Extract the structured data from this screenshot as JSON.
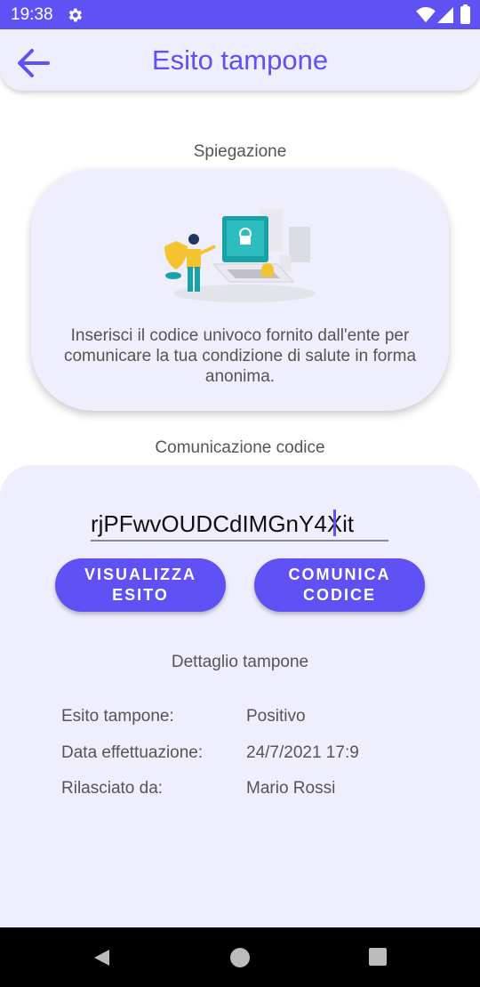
{
  "status_bar": {
    "time": "19:38",
    "icons": [
      "gear-icon",
      "wifi-icon",
      "cell-signal-icon",
      "battery-icon"
    ]
  },
  "app_bar": {
    "title": "Esito tampone",
    "back_icon": "arrow-left-icon"
  },
  "explanation": {
    "label": "Spiegazione",
    "text": "Inserisci il codice univoco fornito dall'ente per comunicare la tua condizione di salute in forma anonima."
  },
  "code_section": {
    "label": "Comunicazione codice",
    "code_value": "rjPFwvOUDCdIMGnY4Xit",
    "view_button": "VISUALIZZA ESITO",
    "send_button": "COMUNICA CODICE"
  },
  "details": {
    "label": "Dettaglio tampone",
    "rows": [
      {
        "key": "Esito tampone:",
        "value": "Positivo"
      },
      {
        "key": "Data effettuazione:",
        "value": "24/7/2021  17:9"
      },
      {
        "key": "Rilasciato da:",
        "value": "Mario Rossi"
      }
    ]
  },
  "colors": {
    "accent": "#5f51f3",
    "surface": "#efeefd",
    "text": "#555555"
  }
}
